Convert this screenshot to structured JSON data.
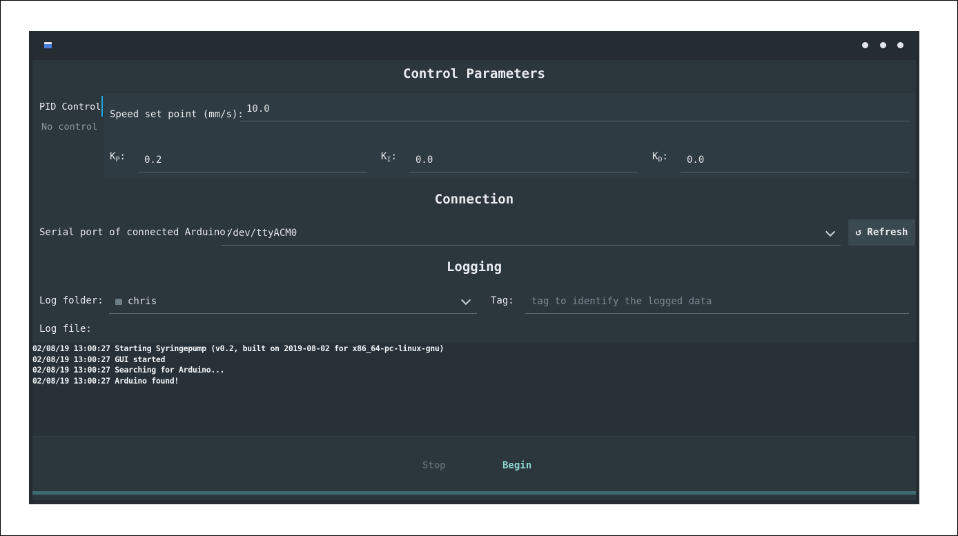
{
  "window": {
    "app_icon": "app-window-icon",
    "wm_buttons": [
      "dot",
      "dot",
      "dot"
    ]
  },
  "control": {
    "title": "Control Parameters",
    "tabs": [
      {
        "label": "PID Control",
        "active": true
      },
      {
        "label": "No control",
        "active": false
      }
    ],
    "speed_label": "Speed set point (mm/s):",
    "speed_value": "10.0",
    "kp_label": "K",
    "kp_sub": "P",
    "kp_colon": ":",
    "kp_value": "0.2",
    "ki_label": "K",
    "ki_sub": "I",
    "ki_colon": ":",
    "ki_value": "0.0",
    "kd_label": "K",
    "kd_sub": "D",
    "kd_colon": ":",
    "kd_value": "0.0"
  },
  "connection": {
    "title": "Connection",
    "port_label": "Serial port of connected Arduino:",
    "port_value": "/dev/ttyACM0",
    "refresh_icon": "refresh-icon",
    "refresh_label": "Refresh"
  },
  "logging": {
    "title": "Logging",
    "folder_label": "Log folder:",
    "folder_icon": "home-icon",
    "folder_value": "chris",
    "tag_label": "Tag:",
    "tag_placeholder": "tag to identify the logged data",
    "file_label": "Log file:",
    "file_value": ""
  },
  "log_lines": [
    "02/08/19 13:00:27 Starting Syringepump (v0.2, built on 2019-08-02 for x86_64-pc-linux-gnu)",
    "02/08/19 13:00:27 GUI started",
    "02/08/19 13:00:27 Searching for Arduino...",
    "02/08/19 13:00:27 Arduino found!"
  ],
  "footer": {
    "stop_label": "Stop",
    "begin_label": "Begin",
    "stop_enabled": false
  },
  "colors": {
    "accent": "#20a8d8",
    "begin": "#8ed4cf",
    "background": "#2b363d"
  }
}
